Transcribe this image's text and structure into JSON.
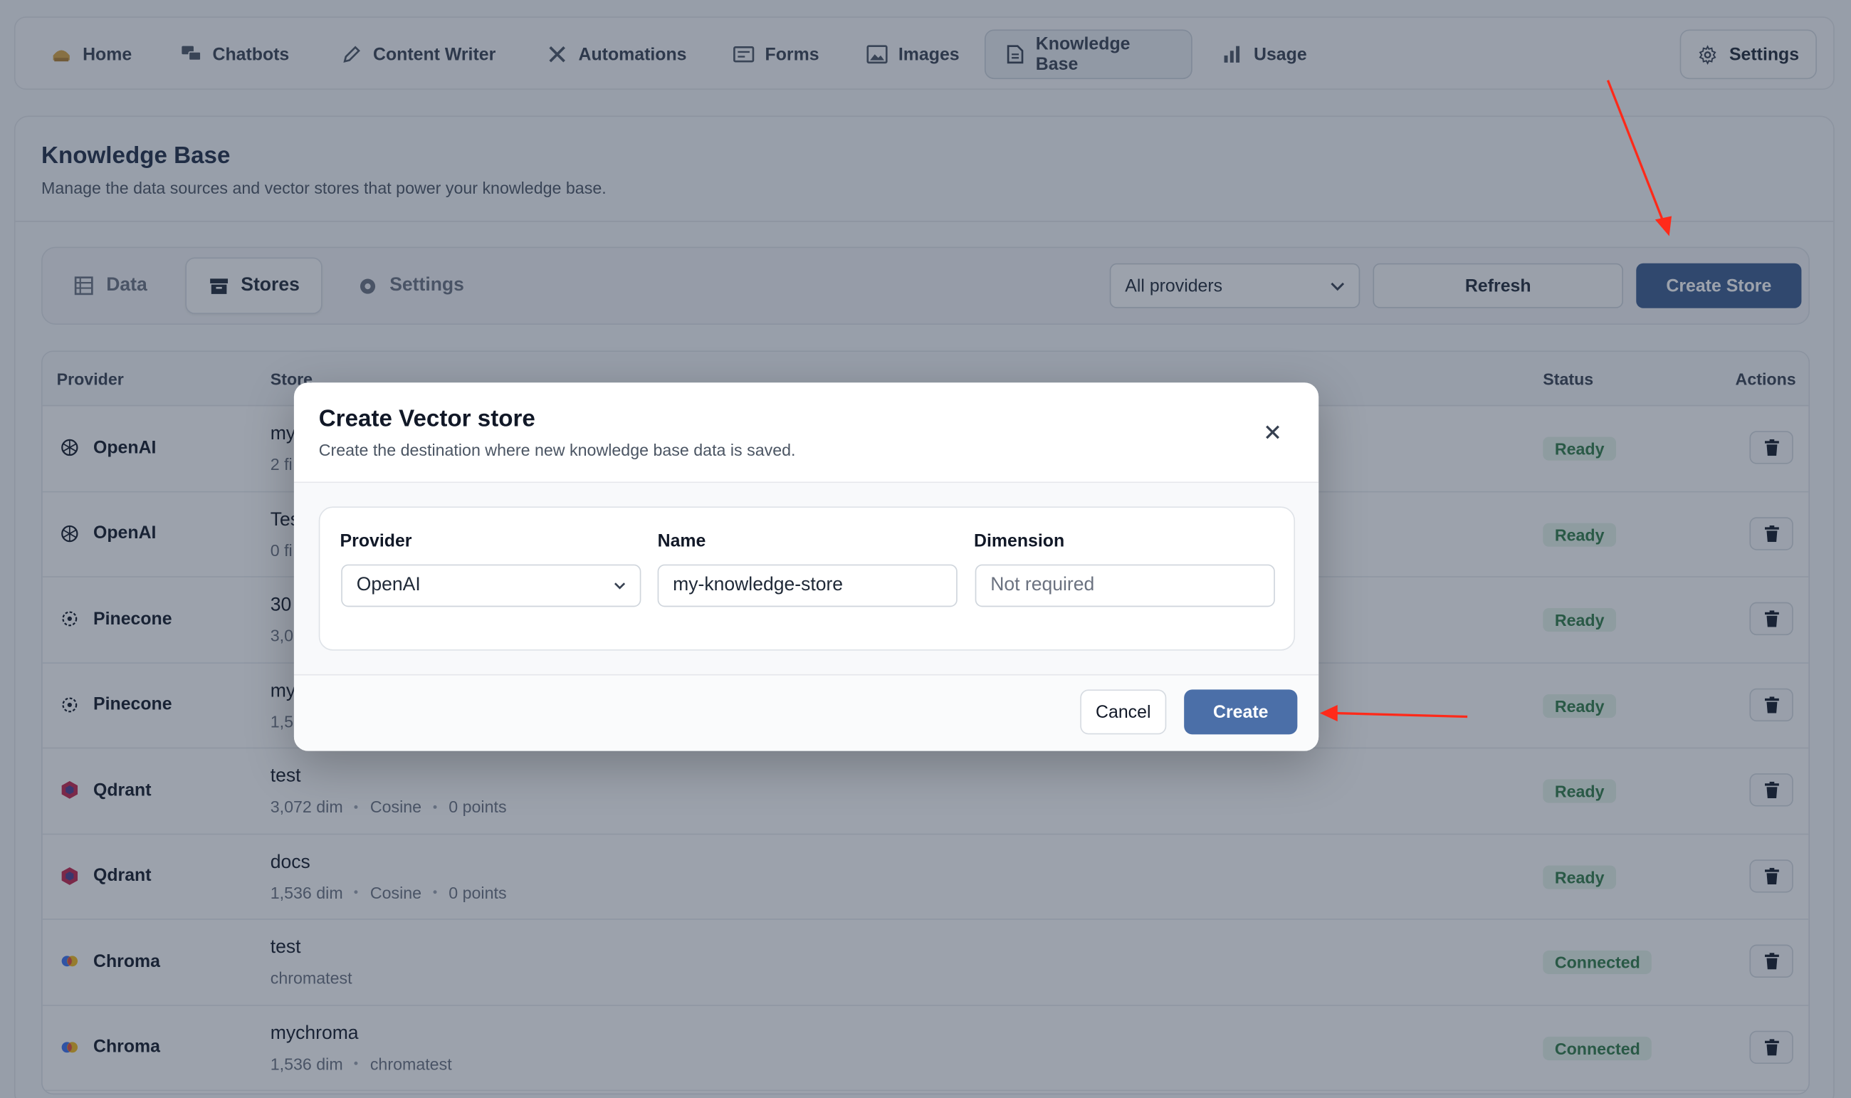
{
  "nav": {
    "items": [
      {
        "label": "Home",
        "icon": "home-icon"
      },
      {
        "label": "Chatbots",
        "icon": "chat-bubbles-icon"
      },
      {
        "label": "Content Writer",
        "icon": "pencil-icon"
      },
      {
        "label": "Automations",
        "icon": "tools-icon"
      },
      {
        "label": "Forms",
        "icon": "form-icon"
      },
      {
        "label": "Images",
        "icon": "image-icon"
      },
      {
        "label": "Knowledge Base",
        "icon": "document-icon"
      },
      {
        "label": "Usage",
        "icon": "bar-chart-icon"
      }
    ],
    "settings_label": "Settings"
  },
  "page": {
    "title": "Knowledge Base",
    "subtitle": "Manage the data sources and vector stores that power your knowledge base."
  },
  "toolbar": {
    "tabs": [
      {
        "label": "Data",
        "icon": "table-icon"
      },
      {
        "label": "Stores",
        "icon": "archive-icon"
      },
      {
        "label": "Settings",
        "icon": "gear-icon"
      }
    ],
    "provider_filter": "All providers",
    "refresh_label": "Refresh",
    "create_store_label": "Create Store"
  },
  "table": {
    "headers": {
      "provider": "Provider",
      "store": "Store",
      "status": "Status",
      "actions": "Actions"
    },
    "rows": [
      {
        "provider": "OpenAI",
        "store": "my",
        "meta": [
          "2 fi"
        ],
        "status": "Ready"
      },
      {
        "provider": "OpenAI",
        "store": "Tes",
        "meta": [
          "0 fi"
        ],
        "status": "Ready"
      },
      {
        "provider": "Pinecone",
        "store": "30",
        "meta": [
          "3,0"
        ],
        "status": "Ready"
      },
      {
        "provider": "Pinecone",
        "store": "my",
        "meta": [
          "1,5"
        ],
        "status": "Ready"
      },
      {
        "provider": "Qdrant",
        "store": "test",
        "meta": [
          "3,072 dim",
          "Cosine",
          "0 points"
        ],
        "status": "Ready"
      },
      {
        "provider": "Qdrant",
        "store": "docs",
        "meta": [
          "1,536 dim",
          "Cosine",
          "0 points"
        ],
        "status": "Ready"
      },
      {
        "provider": "Chroma",
        "store": "test",
        "meta": [
          "chromatest"
        ],
        "status": "Connected"
      },
      {
        "provider": "Chroma",
        "store": "mychroma",
        "meta": [
          "1,536 dim",
          "chromatest"
        ],
        "status": "Connected"
      }
    ]
  },
  "modal": {
    "title": "Create Vector store",
    "description": "Create the destination where new knowledge base data is saved.",
    "fields": {
      "provider_label": "Provider",
      "provider_value": "OpenAI",
      "name_label": "Name",
      "name_value": "my-knowledge-store",
      "dimension_label": "Dimension",
      "dimension_placeholder": "Not required"
    },
    "cancel_label": "Cancel",
    "create_label": "Create"
  },
  "colors": {
    "primary": "#3b5b8f",
    "status_green": "#2f7a45",
    "annotation_red": "#ff2a1a"
  }
}
